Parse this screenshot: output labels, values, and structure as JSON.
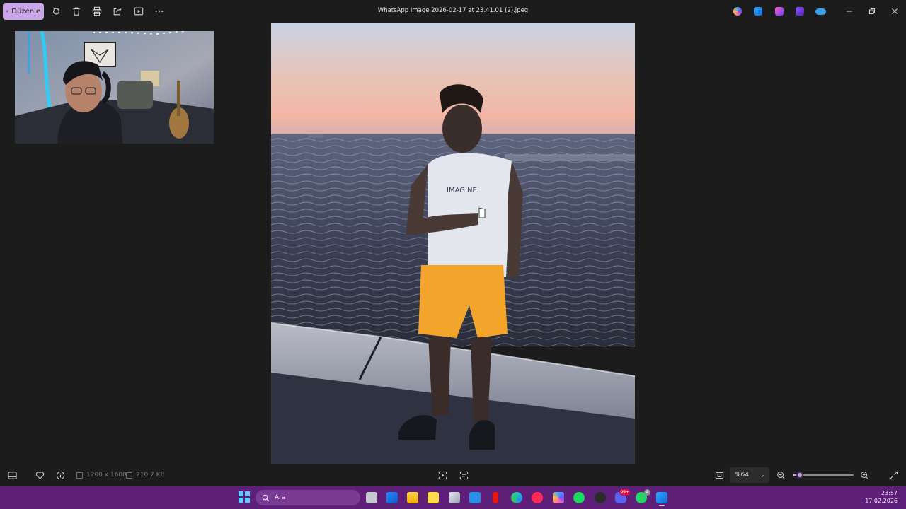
{
  "toolbar": {
    "edit_label": "Düzenle",
    "icons": [
      "rotate-icon",
      "delete-icon",
      "print-icon",
      "share-icon",
      "slideshow-icon",
      "more-icon"
    ]
  },
  "window": {
    "title": "WhatsApp Image 2026-02-17 at 23.41.01 (2).jpeg",
    "app_icons": [
      "copilot-icon",
      "photos-icon",
      "clipchamp-icon",
      "video-editor-icon",
      "onedrive-icon"
    ]
  },
  "status": {
    "dimensions": "1200 x 1600",
    "file_size": "210.7 KB"
  },
  "zoom": {
    "level_label": "%64",
    "level": 0.64,
    "slider_fraction": 0.12
  },
  "taskbar": {
    "search_placeholder": "Ara",
    "badges": {
      "discord": "99+",
      "whatsapp": "4"
    },
    "time": "23:57",
    "date": "17.02.2026"
  },
  "colors": {
    "accent": "#c9a6e8",
    "taskbar": "#5d1f78",
    "background": "#1c1c1c"
  }
}
